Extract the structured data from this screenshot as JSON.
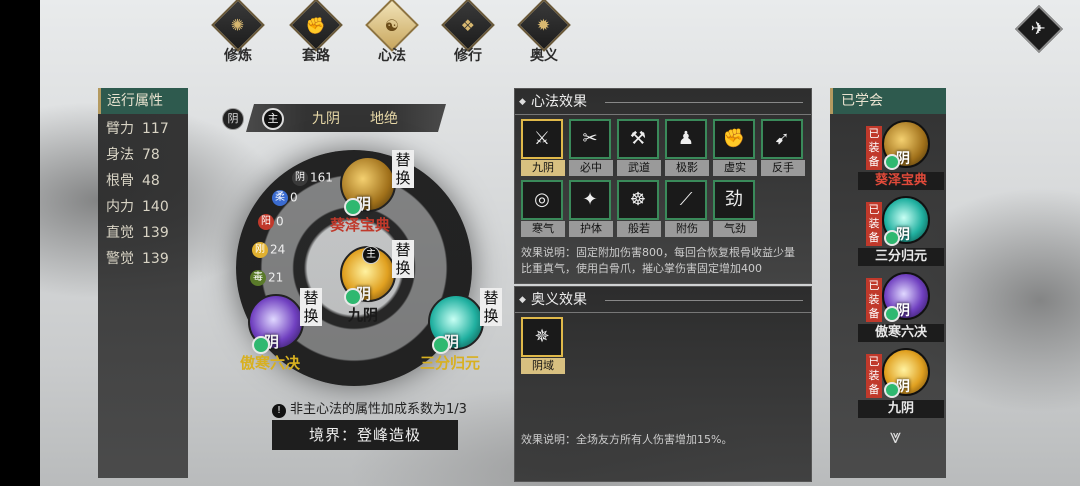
{
  "tabs": [
    {
      "label": "修炼",
      "glyph": "✺"
    },
    {
      "label": "套路",
      "glyph": "✊"
    },
    {
      "label": "心法",
      "glyph": "☯",
      "active": true
    },
    {
      "label": "修行",
      "glyph": "❖"
    },
    {
      "label": "奥义",
      "glyph": "✹"
    }
  ],
  "close_icon": "✈",
  "attributes": {
    "title": "运行属性",
    "rows": [
      {
        "k": "臂力",
        "v": "117"
      },
      {
        "k": "身法",
        "v": "78"
      },
      {
        "k": "根骨",
        "v": "48"
      },
      {
        "k": "内力",
        "v": "140"
      },
      {
        "k": "直觉",
        "v": "139"
      },
      {
        "k": "警觉",
        "v": "139"
      }
    ]
  },
  "mode": {
    "yin": "阴",
    "zhu": "主",
    "a": "九阴",
    "b": "地绝"
  },
  "wheel_stats": [
    {
      "label": "阴",
      "value": "161",
      "color": "#3a3a3a"
    },
    {
      "label": "柔",
      "value": "0",
      "color": "#3a6bd0"
    },
    {
      "label": "阳",
      "value": "0",
      "color": "#c0392b"
    },
    {
      "label": "刚",
      "value": "24",
      "color": "#e0b030"
    },
    {
      "label": "毒",
      "value": "21",
      "color": "#5a7a2a"
    }
  ],
  "wheel_skills": {
    "top": {
      "name": "葵泽宝典",
      "yin": "阴",
      "swap": "替换",
      "name_color": "#c0392b"
    },
    "center": {
      "name": "九阴",
      "yin": "阴",
      "swap": "替换",
      "zhu": "主",
      "name_color": "#1a1a1a"
    },
    "left": {
      "name": "傲寒六决",
      "yin": "阴",
      "swap": "替换",
      "name_color": "#d8b020"
    },
    "right": {
      "name": "三分归元",
      "yin": "阴",
      "swap": "替换",
      "name_color": "#d8b020"
    }
  },
  "note": "非主心法的属性加成系数为1/3",
  "realm": "境界：登峰造极",
  "xinfa_effects": {
    "title": "心法效果",
    "items": [
      {
        "label": "九阴",
        "glyph": "⚔",
        "active": true
      },
      {
        "label": "必中",
        "glyph": "✂"
      },
      {
        "label": "武道",
        "glyph": "⚒"
      },
      {
        "label": "极影",
        "glyph": "♟"
      },
      {
        "label": "虚实",
        "glyph": "✊"
      },
      {
        "label": "反手",
        "glyph": "➹"
      },
      {
        "label": "寒气",
        "glyph": "◎"
      },
      {
        "label": "护体",
        "glyph": "✦"
      },
      {
        "label": "般若",
        "glyph": "☸"
      },
      {
        "label": "附伤",
        "glyph": "⟋"
      },
      {
        "label": "气劲",
        "glyph": "劲"
      }
    ],
    "desc": "效果说明：固定附加伤害800，每回合恢复根骨收益少量比重真气，使用白骨爪，摧心掌伤害固定增加400"
  },
  "aoyi_effects": {
    "title": "奥义效果",
    "items": [
      {
        "label": "阴域",
        "glyph": "✵",
        "active": true
      }
    ],
    "desc": "效果说明：全场友方所有人伤害增加15%。"
  },
  "learned": {
    "title": "已学会",
    "equipped_tag": "已装备",
    "items": [
      {
        "name": "葵泽宝典",
        "yin": "阴",
        "name_color": "#e04a3a"
      },
      {
        "name": "三分归元",
        "yin": "阴",
        "name_color": "#e8e8e8"
      },
      {
        "name": "傲寒六决",
        "yin": "阴",
        "name_color": "#e8e8e8"
      },
      {
        "name": "九阴",
        "yin": "阴",
        "name_color": "#e8e8e8"
      }
    ]
  },
  "more_icon": "⩔"
}
